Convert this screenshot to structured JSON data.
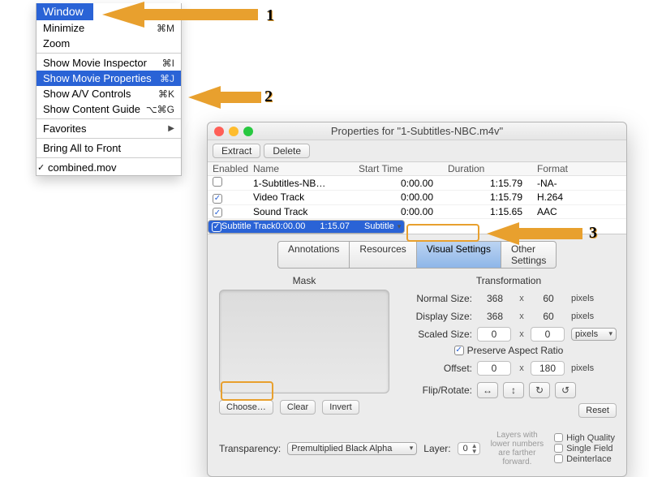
{
  "menu": {
    "title": "Window",
    "items": [
      {
        "label": "Minimize",
        "shortcut": "⌘M",
        "sep": false
      },
      {
        "label": "Zoom",
        "shortcut": "",
        "sep": false
      },
      {
        "sep": true
      },
      {
        "label": "Show Movie Inspector",
        "shortcut": "⌘I",
        "sep": false
      },
      {
        "label": "Show Movie Properties",
        "shortcut": "⌘J",
        "sep": false,
        "highlight": true
      },
      {
        "label": "Show A/V Controls",
        "shortcut": "⌘K",
        "sep": false
      },
      {
        "label": "Show Content Guide",
        "shortcut": "⌥⌘G",
        "sep": false
      },
      {
        "sep": true
      },
      {
        "label": "Favorites",
        "shortcut": "",
        "sep": false,
        "submenu": true
      },
      {
        "sep": true
      },
      {
        "label": "Bring All to Front",
        "shortcut": "",
        "sep": false
      },
      {
        "sep": true
      },
      {
        "label": "combined.mov",
        "shortcut": "",
        "sep": false,
        "checked": true
      }
    ]
  },
  "callouts": {
    "one": "1",
    "two": "2",
    "three": "3"
  },
  "colors": {
    "annotation": "#e8a02e",
    "highlight": "#2a63d6"
  },
  "win": {
    "title": "Properties for \"1-Subtitles-NBC.m4v\"",
    "toolbar": {
      "extract": "Extract",
      "delete": "Delete"
    },
    "tracks_head": {
      "enabled": "Enabled",
      "name": "Name",
      "start": "Start Time",
      "duration": "Duration",
      "format": "Format"
    },
    "tracks": [
      {
        "enabled": false,
        "name": "1-Subtitles-NB…",
        "start": "0:00.00",
        "duration": "1:15.79",
        "format": "-NA-"
      },
      {
        "enabled": true,
        "name": "Video Track",
        "start": "0:00.00",
        "duration": "1:15.79",
        "format": "H.264"
      },
      {
        "enabled": true,
        "name": "Sound Track",
        "start": "0:00.00",
        "duration": "1:15.65",
        "format": "AAC"
      },
      {
        "enabled": true,
        "name": "Subtitle Track",
        "start": "0:00.00",
        "duration": "1:15.07",
        "format": "Subtitle",
        "selected": true
      }
    ],
    "tabs": {
      "annotations": "Annotations",
      "resources": "Resources",
      "visual": "Visual Settings",
      "other": "Other Settings"
    },
    "mask": {
      "title": "Mask",
      "choose": "Choose…",
      "clear": "Clear",
      "invert": "Invert"
    },
    "xform": {
      "title": "Transformation",
      "normal_label": "Normal Size:",
      "display_label": "Display Size:",
      "scaled_label": "Scaled Size:",
      "offset_label": "Offset:",
      "flip_label": "Flip/Rotate:",
      "preserve_label": "Preserve Aspect Ratio",
      "preserve_checked": true,
      "pixels": "pixels",
      "x": "x",
      "normal_w": "368",
      "normal_h": "60",
      "display_w": "368",
      "display_h": "60",
      "scaled_w": "0",
      "scaled_h": "0",
      "scaled_unit": "pixels",
      "offset_x": "0",
      "offset_y": "180",
      "reset": "Reset"
    },
    "footer": {
      "transparency_label": "Transparency:",
      "transparency_value": "Premultiplied Black Alpha",
      "layer_label": "Layer:",
      "layer_value": "0",
      "hint": "Layers with lower numbers are farther forward.",
      "opt_hq": "High Quality",
      "opt_sf": "Single Field",
      "opt_di": "Deinterlace"
    }
  }
}
